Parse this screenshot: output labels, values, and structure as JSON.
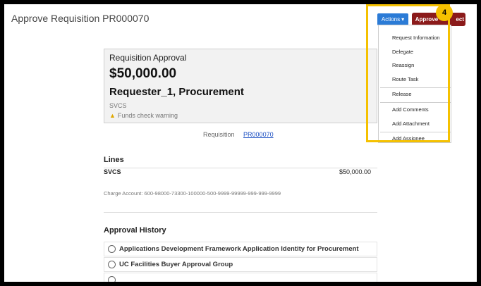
{
  "page": {
    "title": "Approve Requisition PR000070"
  },
  "toolbar": {
    "actions_label": "Actions",
    "approve_label": "Approve",
    "reject_label": "ect"
  },
  "actions_menu": {
    "items": [
      "Request Information",
      "Delegate",
      "Reassign",
      "Route Task",
      "Release",
      "Add Comments",
      "Add Attachment",
      "Add Assignee"
    ]
  },
  "annotation": {
    "step_number": "4"
  },
  "card": {
    "label": "Requisition Approval",
    "amount": "$50,000.00",
    "requester": "Requester_1, Procurement",
    "business_unit": "SVCS",
    "warning": "Funds check warning"
  },
  "requisition": {
    "label": "Requisition",
    "number": "PR000070"
  },
  "lines": {
    "title": "Lines",
    "items": [
      {
        "name": "SVCS",
        "amount": "$50,000.00",
        "charge_account": "Charge Account: 600-98000-73300-100000-500-9999-99999-999-999-9999"
      }
    ]
  },
  "approval_history": {
    "title": "Approval History",
    "items": [
      "Applications Development Framework Application Identity for Procurement",
      "UC Facilities Buyer Approval Group"
    ]
  }
}
